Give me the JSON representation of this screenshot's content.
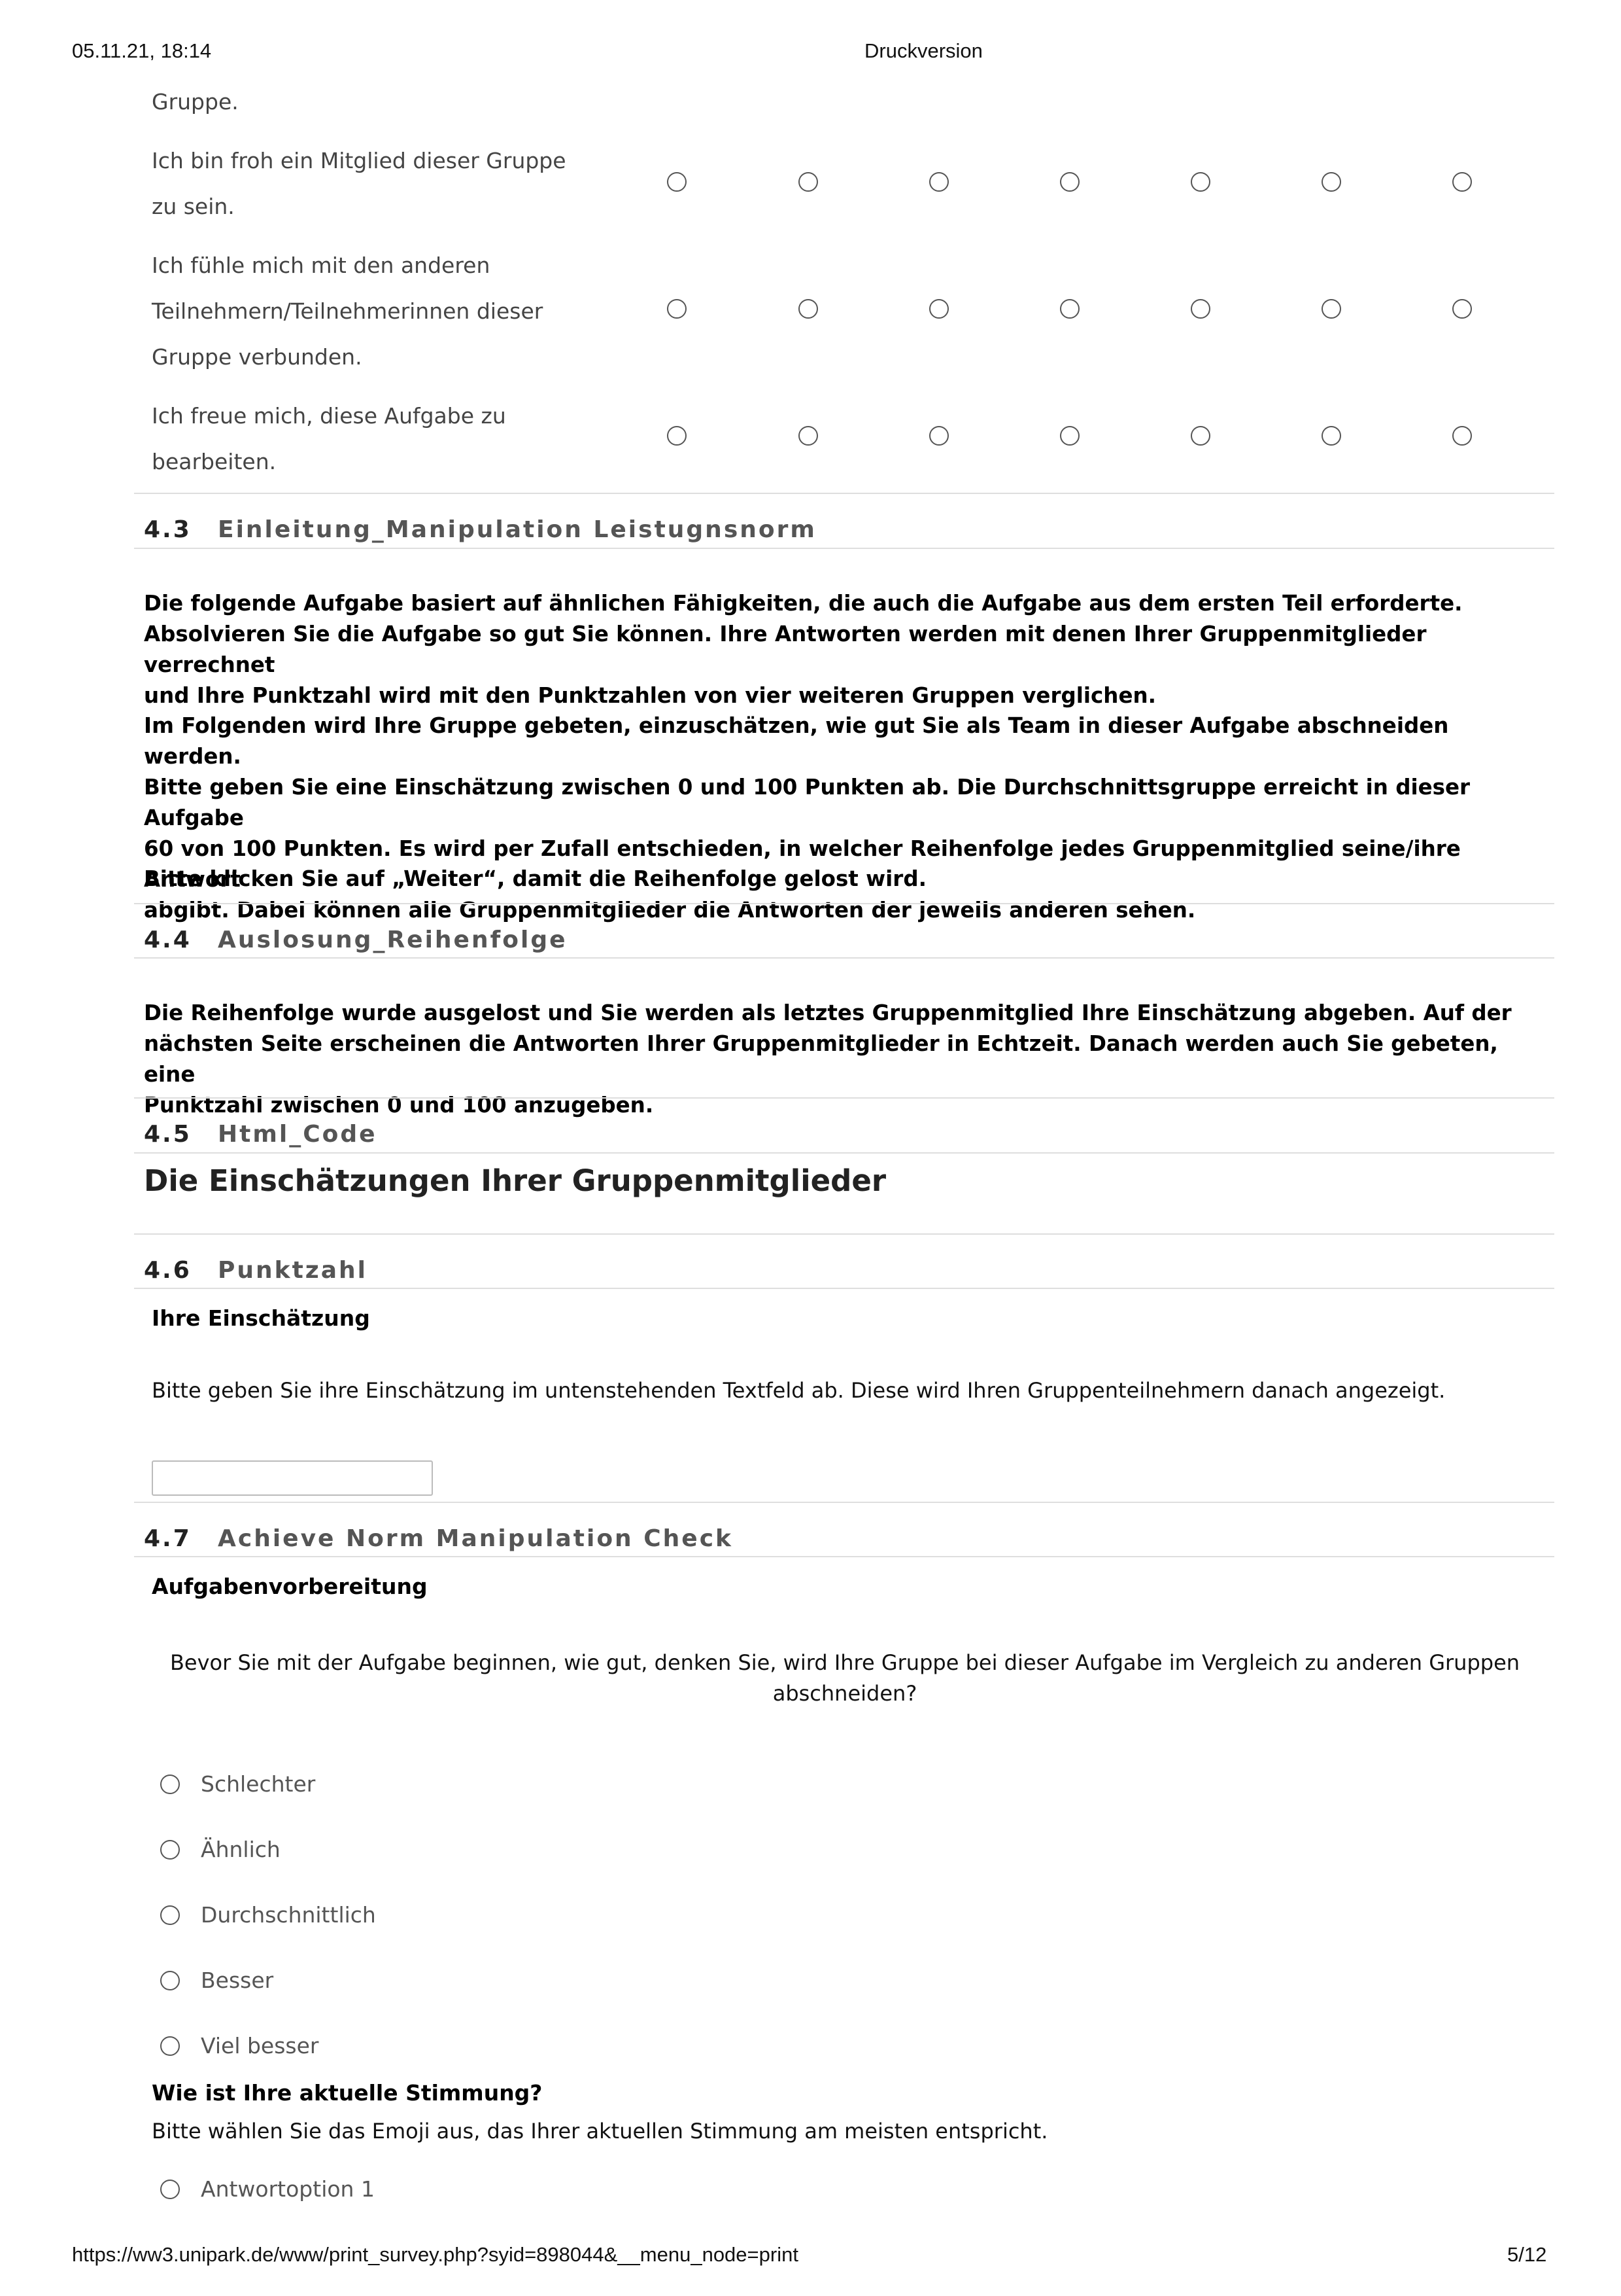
{
  "print_header": {
    "datetime": "05.11.21, 18:14",
    "title": "Druckversion"
  },
  "print_footer": {
    "url": "https://ww3.unipark.de/www/print_survey.php?syid=898044&__menu_node=print",
    "page": "5/12"
  },
  "matrix": {
    "continued_text": "Gruppe.",
    "rows": [
      {
        "lines": [
          "Ich bin froh ein Mitglied dieser Gruppe",
          "zu sein."
        ]
      },
      {
        "lines": [
          "Ich fühle mich mit den anderen",
          "Teilnehmern/Teilnehmerinnen dieser",
          "Gruppe verbunden."
        ]
      },
      {
        "lines": [
          "Ich freue mich, diese Aufgabe zu",
          "bearbeiten."
        ]
      }
    ]
  },
  "sections": {
    "s43": {
      "number": "4.3",
      "title": "Einleitung_Manipulation Leistugnsnorm",
      "paragraphs": [
        [
          "Die folgende Aufgabe basiert auf ähnlichen Fähigkeiten, die auch die Aufgabe aus dem ersten Teil erforderte.",
          "Absolvieren Sie die Aufgabe so gut Sie können. Ihre Antworten werden mit denen Ihrer Gruppenmitglieder verrechnet",
          "und Ihre Punktzahl wird mit den Punktzahlen von vier weiteren Gruppen verglichen."
        ],
        [
          "Im Folgenden wird Ihre Gruppe gebeten, einzuschätzen, wie gut Sie als Team in dieser Aufgabe abschneiden werden.",
          "Bitte geben Sie eine Einschätzung zwischen 0 und 100 Punkten ab. Die Durchschnittsgruppe erreicht in dieser Aufgabe",
          "60 von 100 Punkten. Es wird per Zufall entschieden, in welcher Reihenfolge jedes Gruppenmitglied seine/ihre Antwort",
          "abgibt. Dabei können alle Gruppenmitglieder die Antworten der jeweils anderen sehen."
        ],
        [
          "Bitte klicken Sie auf „Weiter“, damit die Reihenfolge gelost wird."
        ]
      ]
    },
    "s44": {
      "number": "4.4",
      "title": "Auslosung_Reihenfolge",
      "paragraph": [
        "Die Reihenfolge wurde ausgelost und Sie werden als letztes Gruppenmitglied Ihre Einschätzung abgeben. Auf der",
        "nächsten Seite erscheinen die Antworten Ihrer Gruppenmitglieder in Echtzeit. Danach werden auch Sie gebeten, eine",
        "Punktzahl zwischen 0 und 100 anzugeben."
      ]
    },
    "s45": {
      "number": "4.5",
      "title": "Html_Code",
      "heading": "Die Einschätzungen Ihrer Gruppenmitglieder"
    },
    "s46": {
      "number": "4.6",
      "title": "Punktzahl",
      "question": "Ihre Einschätzung",
      "instruction": "Bitte geben Sie ihre Einschätzung im untenstehenden Textfeld ab. Diese wird Ihren Gruppenteilnehmern danach angezeigt.",
      "input_value": ""
    },
    "s47": {
      "number": "4.7",
      "title": "Achieve Norm Manipulation Check",
      "question": "Aufgabenvorbereitung",
      "prompt": [
        "Bevor Sie mit der Aufgabe beginnen, wie gut, denken Sie, wird Ihre Gruppe bei dieser Aufgabe im Vergleich zu anderen Gruppen",
        "abschneiden?"
      ],
      "options": [
        "Schlechter",
        "Ähnlich",
        "Durchschnittlich",
        "Besser",
        "Viel besser"
      ],
      "mood_question": "Wie ist Ihre aktuelle Stimmung?",
      "mood_instruction": "Bitte wählen Sie das Emoji aus, das Ihrer aktuellen Stimmung am meisten entspricht.",
      "mood_options": [
        "Antwortoption 1"
      ]
    }
  }
}
